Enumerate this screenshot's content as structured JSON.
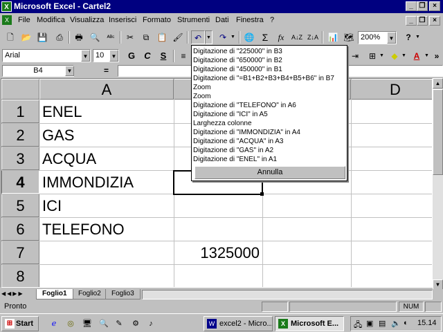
{
  "window": {
    "title": "Microsoft Excel - Cartel2"
  },
  "menu": [
    "File",
    "Modifica",
    "Visualizza",
    "Inserisci",
    "Formato",
    "Strumenti",
    "Dati",
    "Finestra",
    "?"
  ],
  "toolbar": {
    "zoom": "200%",
    "font": "Arial",
    "size": "10",
    "bold": "G",
    "italic": "C",
    "underline": "S"
  },
  "formula": {
    "cell_ref": "B4",
    "equals": "=",
    "content": ""
  },
  "undo_list": {
    "items": [
      "Digitazione di \"225000\" in B3",
      "Digitazione di \"650000\" in B2",
      "Digitazione di \"450000\" in B1",
      "Digitazione di \"=B1+B2+B3+B4+B5+B6\" in B7",
      "Zoom",
      "Zoom",
      "Digitazione di \"TELEFONO\" in A6",
      "Digitazione di \"ICI\" in A5",
      "Larghezza colonne",
      "Digitazione di \"IMMONDIZIA\" in A4",
      "Digitazione di \"ACQUA\" in A3",
      "Digitazione di \"GAS\" in A2",
      "Digitazione di \"ENEL\" in A1"
    ],
    "cancel": "Annulla"
  },
  "sheet": {
    "columns": [
      "A",
      "D"
    ],
    "rows": [
      "1",
      "2",
      "3",
      "4",
      "5",
      "6",
      "7",
      "8"
    ],
    "col_a": [
      "ENEL",
      "GAS",
      "ACQUA",
      "IMMONDIZIA",
      "ICI",
      "TELEFONO",
      "",
      ""
    ],
    "b7": "1325000"
  },
  "tabs": [
    "Foglio1",
    "Foglio2",
    "Foglio3"
  ],
  "status": {
    "text": "Pronto",
    "num": "NUM"
  },
  "taskbar": {
    "start": "Start",
    "tasks": [
      "excel2 - Micro...",
      "Microsoft E..."
    ],
    "clock": "15.14"
  },
  "colors": {
    "titlebar": "#000080",
    "face": "#c0c0c0",
    "excel_green": "#1a7a1a"
  }
}
